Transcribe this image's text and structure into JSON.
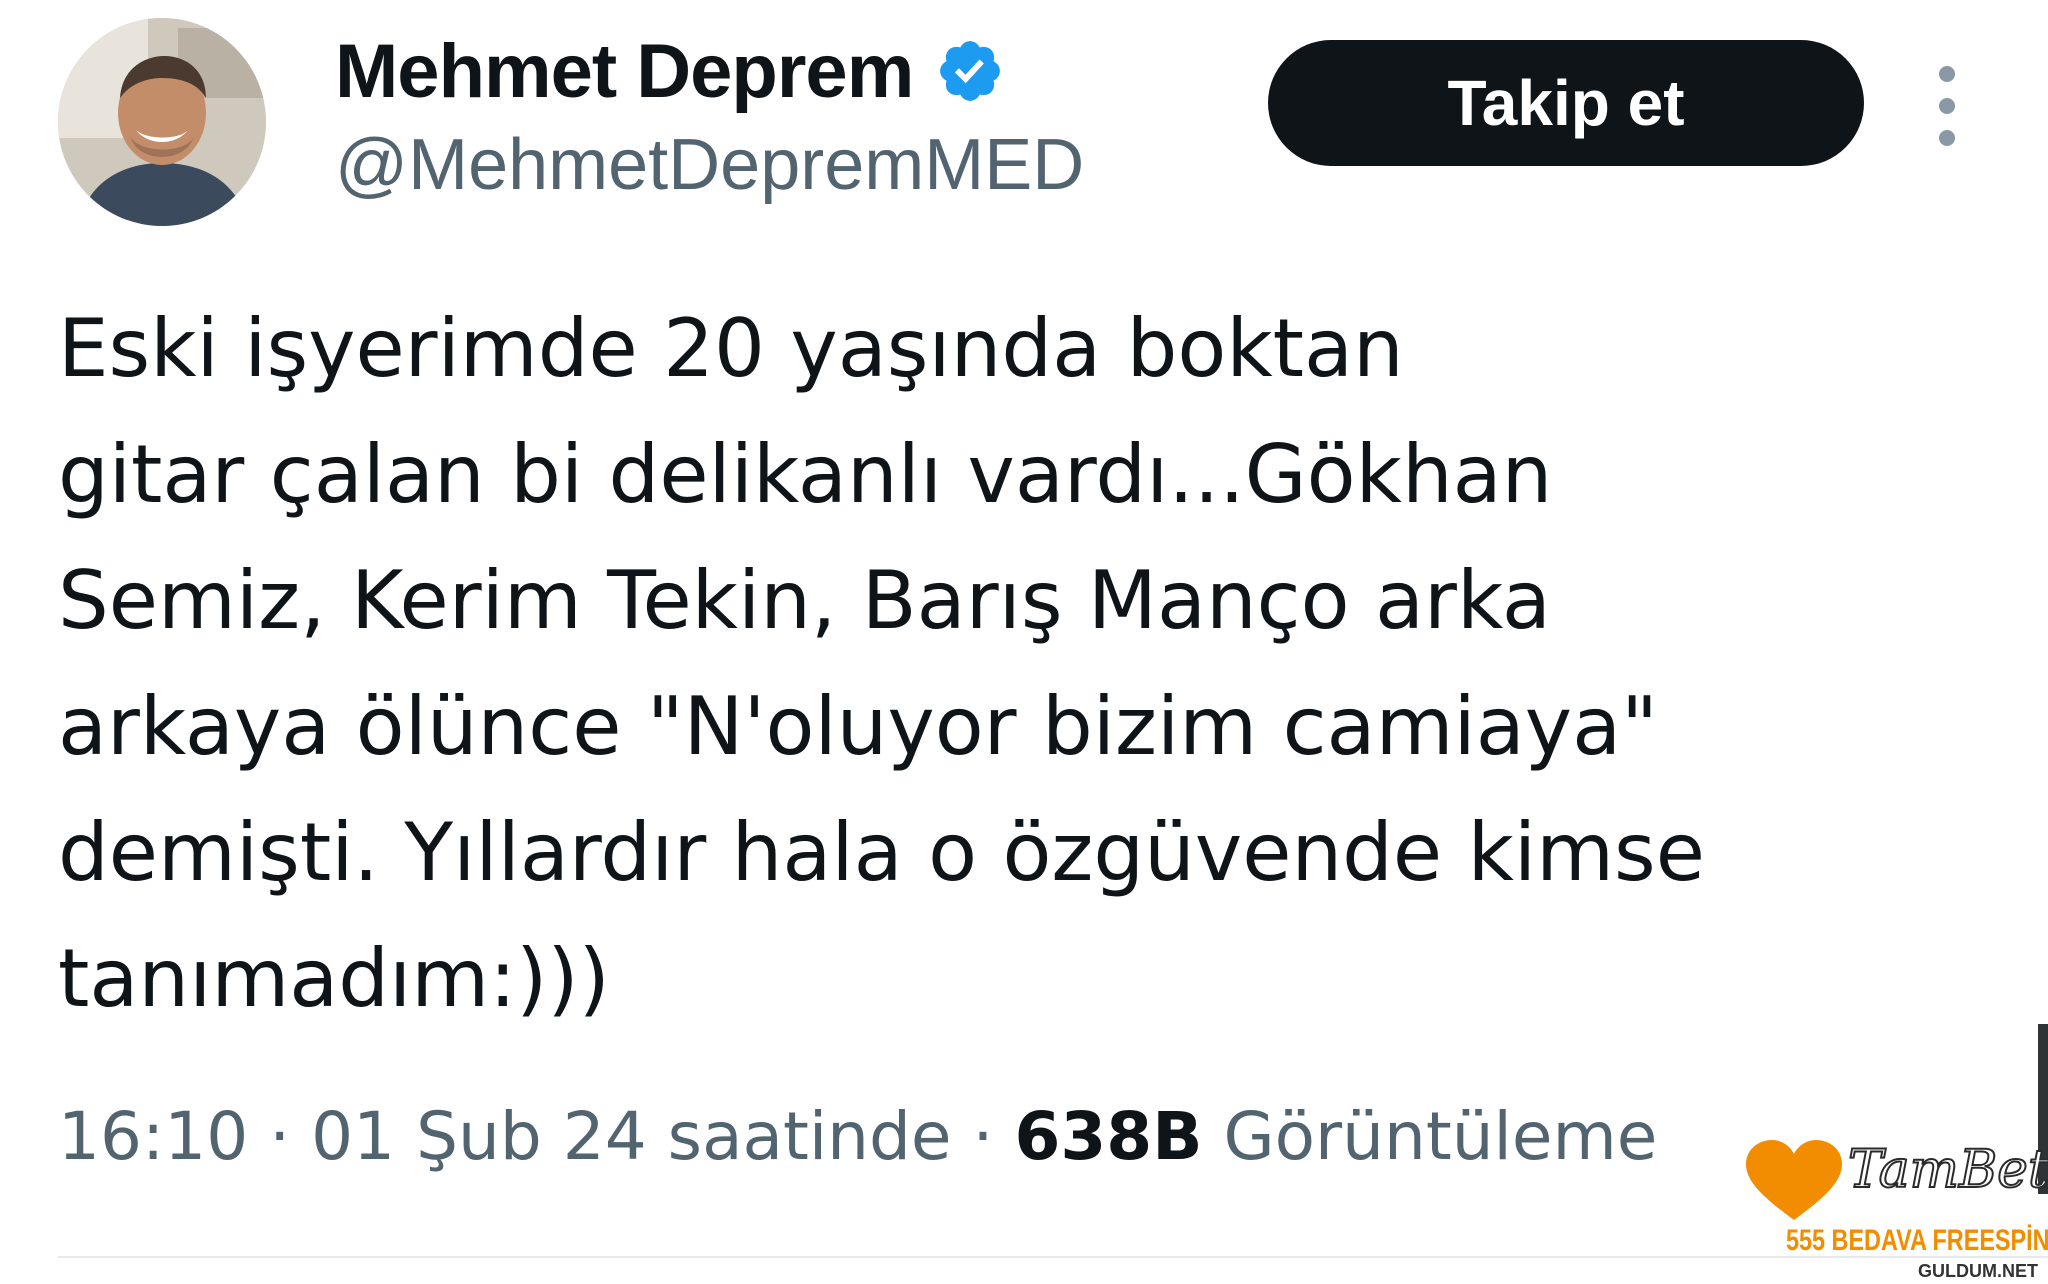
{
  "author": {
    "display_name": "Mehmet Deprem",
    "handle": "@MehmetDepremMED",
    "verified": true,
    "avatar_alt": "profile photo"
  },
  "follow_button": {
    "label": "Takip et"
  },
  "tweet": {
    "lines": [
      "Eski işyerimde 20 yaşında boktan",
      "gitar çalan bi delikanlı vardı...Gökhan",
      "Semiz, Kerim Tekin, Barış Manço arka",
      "arkaya ölünce \"N'oluyor bizim camiaya\"",
      "demişti. Yıllardır hala o özgüvende kimse",
      "tanımadım:)))"
    ]
  },
  "meta": {
    "time": "16:10",
    "separator": "·",
    "date": "01 Şub 24 saatinde",
    "views_count": "638B",
    "views_label": "Görüntüleme"
  },
  "overlay": {
    "ad_brand": "TamBet",
    "ad_promo": "555 BEDAVA FREESPİN",
    "watermark": "GULDUM.NET"
  },
  "colors": {
    "text_primary": "#0f1419",
    "text_secondary": "#536471",
    "verified_blue": "#1d9bf0",
    "ad_orange": "#f28c00"
  },
  "icons": {
    "verified": "verified-badge-icon",
    "more": "more-vertical-icon",
    "ad_logo": "heart-icon"
  }
}
